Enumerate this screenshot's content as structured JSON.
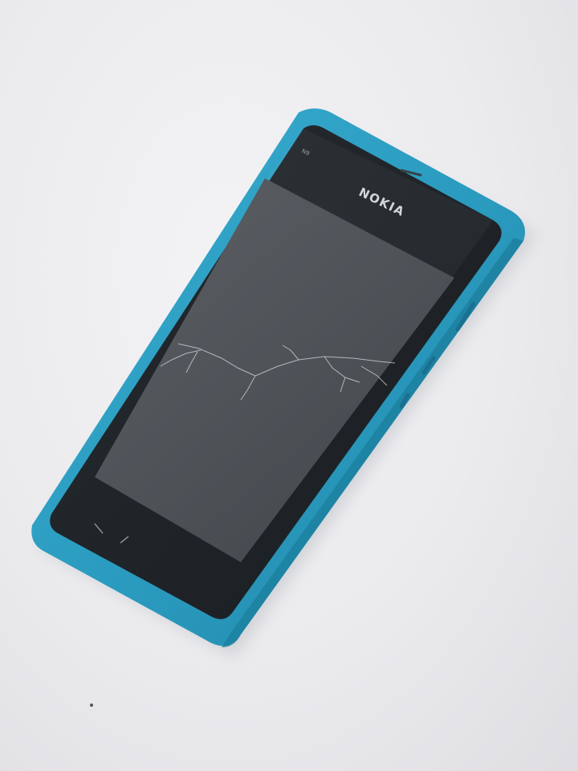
{
  "photo": {
    "subject": "smartphone",
    "brand_label": "NOKIA",
    "model_label": "N9",
    "body_color": "#2b9cc0",
    "bezel_color": "#1e2328",
    "screen_color": "#4d5156",
    "background_color": "#ebebee",
    "screen_condition": "cracked"
  }
}
